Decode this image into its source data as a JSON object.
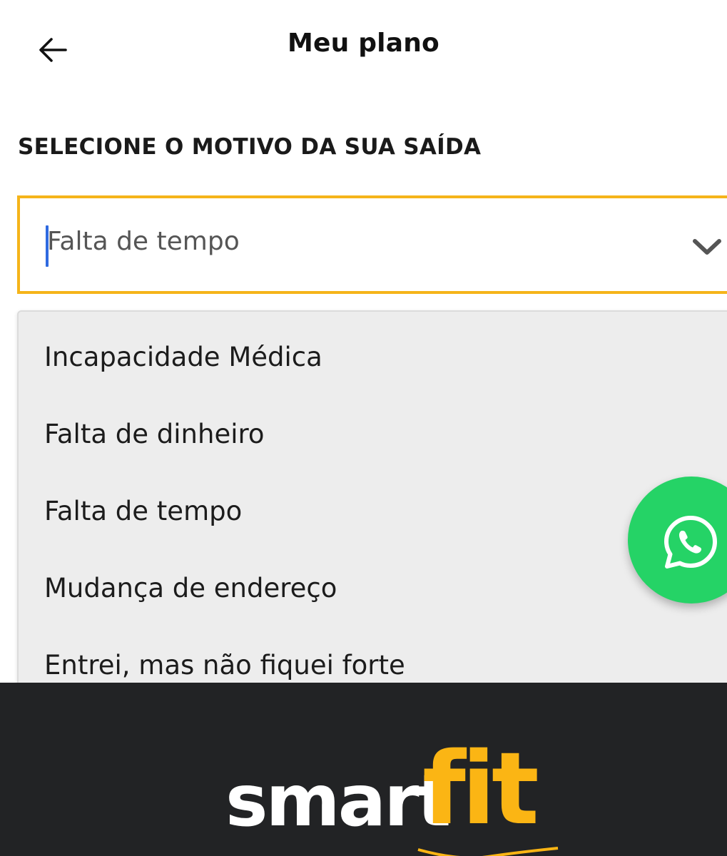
{
  "header": {
    "title": "Meu plano",
    "back_icon": "arrow-left-icon"
  },
  "form": {
    "section_label": "SELECIONE O MOTIVO DA SUA SAÍDA",
    "select": {
      "value": "Falta de tempo",
      "icon": "chevron-down-icon"
    },
    "options": [
      "Incapacidade Médica",
      "Falta de dinheiro",
      "Falta de tempo",
      "Mudança de endereço",
      "Entrei, mas não fiquei forte"
    ]
  },
  "floating_action": {
    "icon": "whatsapp-icon",
    "color": "#25d366"
  },
  "footer": {
    "brand_part1": "smart",
    "brand_part2": "fit",
    "brand_colors": {
      "smart": "#ffffff",
      "fit": "#fbb514",
      "background": "#222325"
    }
  },
  "colors": {
    "accent_border": "#f5b41a",
    "caret": "#2f6ae0",
    "dropdown_bg": "#ededed"
  }
}
